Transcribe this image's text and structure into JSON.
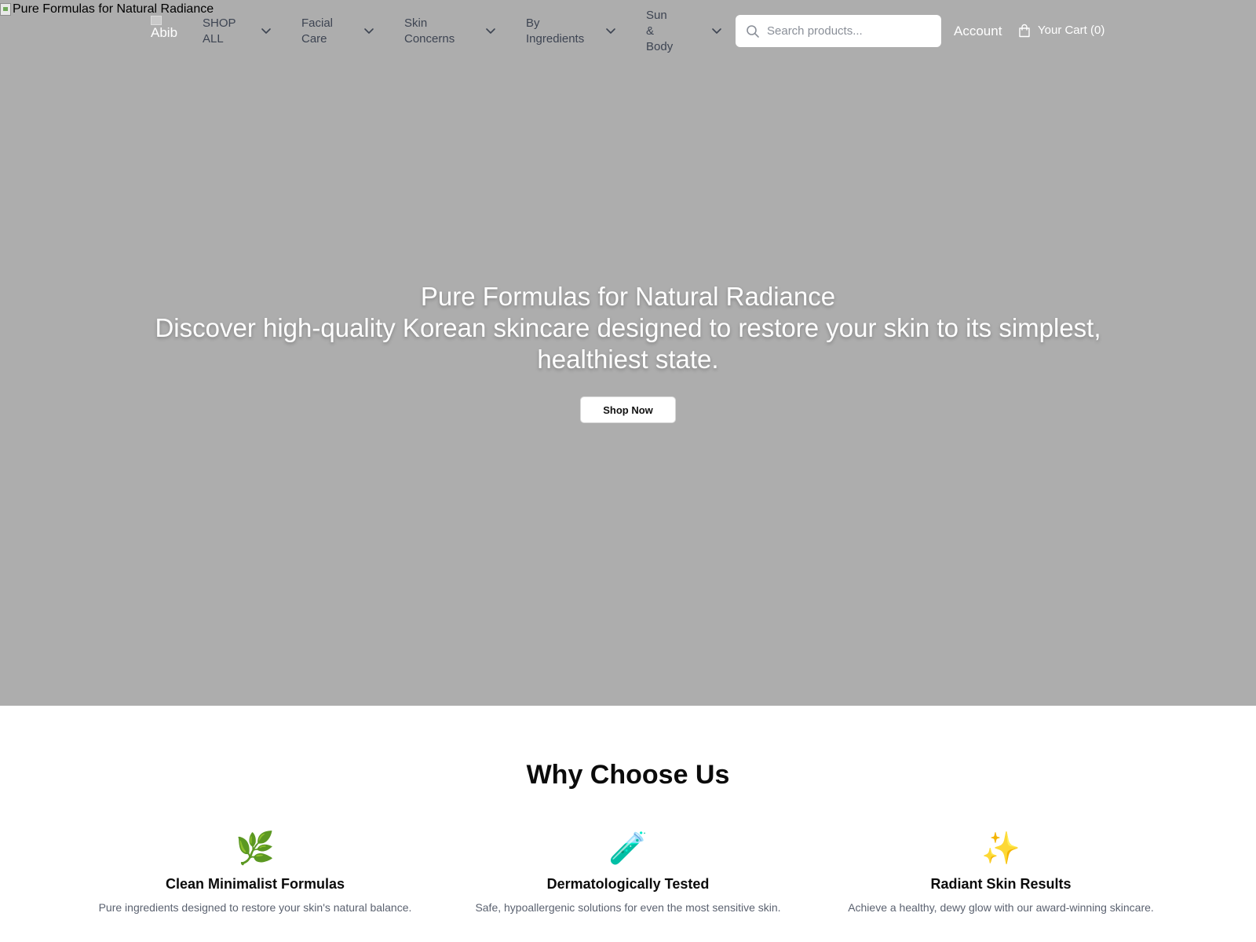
{
  "hero": {
    "image_alt": "Pure Formulas for Natural Radiance",
    "title": "Pure Formulas for Natural Radiance",
    "subtitle": "Discover high-quality Korean skincare designed to restore your skin to its simplest, healthiest state.",
    "cta_label": "Shop Now"
  },
  "header": {
    "logo_alt": "Abib",
    "nav": [
      {
        "label": "SHOP\nALL",
        "icon": "chevron-down-icon"
      },
      {
        "label": "Facial\nCare",
        "icon": "chevron-down-icon"
      },
      {
        "label": "Skin\nConcerns",
        "icon": "chevron-down-icon"
      },
      {
        "label": "By\nIngredients",
        "icon": "chevron-down-icon"
      },
      {
        "label": "Sun &\nBody",
        "icon": "chevron-down-icon"
      }
    ],
    "search": {
      "placeholder": "Search products...",
      "value": "",
      "icon": "search-icon"
    },
    "account_label": "Account",
    "cart": {
      "label": "Your Cart (0)",
      "icon": "shopping-bag-icon"
    }
  },
  "why": {
    "title": "Why Choose Us",
    "features": [
      {
        "icon": "🌿",
        "icon_name": "herb-icon",
        "title": "Clean Minimalist Formulas",
        "desc": "Pure ingredients designed to restore your skin's natural balance."
      },
      {
        "icon": "🧪",
        "icon_name": "test-tube-icon",
        "title": "Dermatologically Tested",
        "desc": "Safe, hypoallergenic solutions for even the most sensitive skin."
      },
      {
        "icon": "✨",
        "icon_name": "sparkles-icon",
        "title": "Radiant Skin Results",
        "desc": "Achieve a healthy, dewy glow with our award-winning skincare."
      }
    ]
  },
  "colors": {
    "hero_bg": "#adadad",
    "nav_text": "#3d4452",
    "muted_text": "#5b6270"
  }
}
